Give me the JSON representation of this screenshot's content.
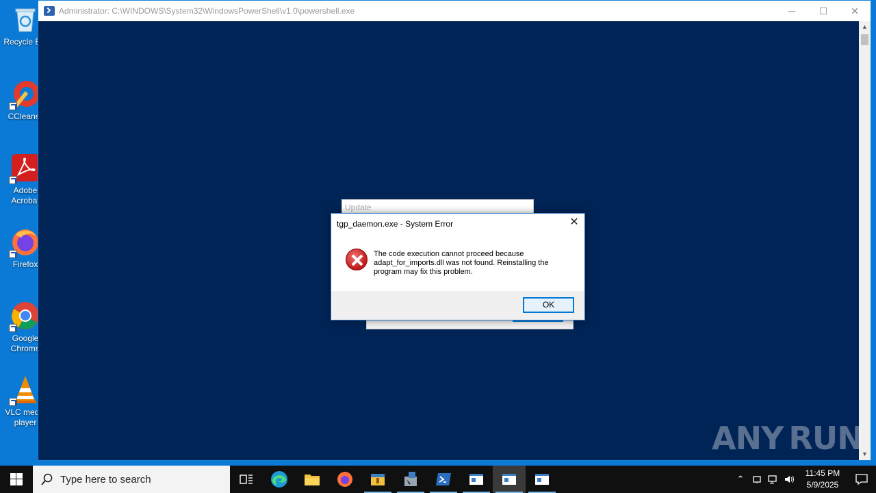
{
  "desktop": {
    "icons": [
      {
        "label_line1": "Recycle Bin",
        "label_line2": ""
      },
      {
        "label_line1": "CCleaner",
        "label_line2": ""
      },
      {
        "label_line1": "Adobe",
        "label_line2": "Acrobat"
      },
      {
        "label_line1": "Firefox",
        "label_line2": ""
      },
      {
        "label_line1": "Google",
        "label_line2": "Chrome"
      },
      {
        "label_line1": "VLC media",
        "label_line2": "player"
      }
    ]
  },
  "powershell": {
    "title": "Administrator: C:\\WINDOWS\\System32\\WindowsPowerShell\\v1.0\\powershell.exe",
    "minimize": "─",
    "maximize": "☐",
    "close": "✕"
  },
  "update_window": {
    "title": "Update"
  },
  "error_dialog": {
    "title": "tgp_daemon.exe - System Error",
    "message": "The code execution cannot proceed because adapt_for_imports.dll was not found. Reinstalling the program may fix this problem.",
    "ok_label": "OK",
    "close": "✕"
  },
  "watermark": {
    "left": "ANY",
    "right": "RUN"
  },
  "taskbar": {
    "search_placeholder": "Type here to search",
    "time": "11:45 PM",
    "date": "5/9/2025",
    "accent": "#76b9ed"
  }
}
